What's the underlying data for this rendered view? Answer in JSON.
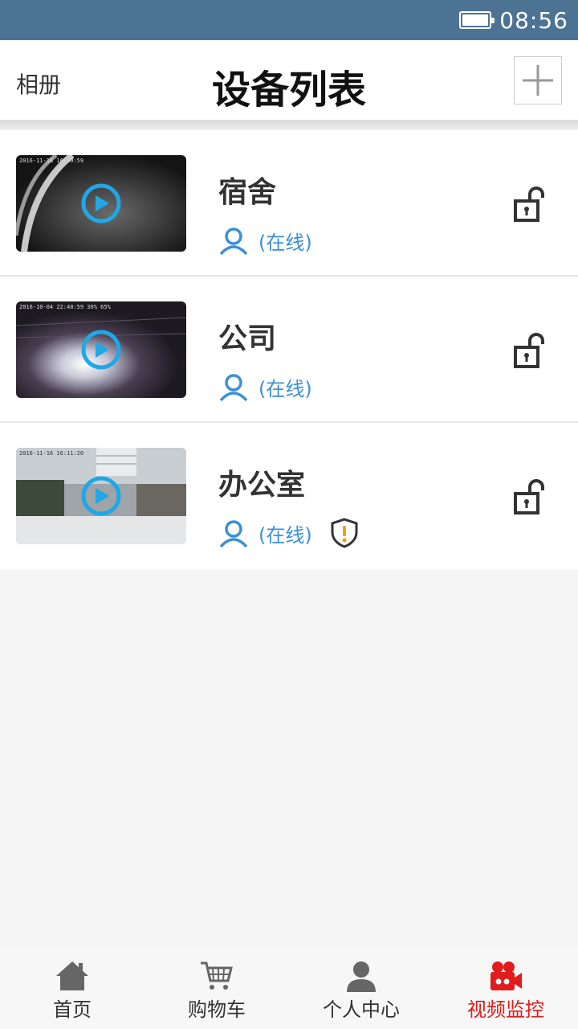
{
  "status_bar": {
    "time": "08:56"
  },
  "header": {
    "left_label": "相册",
    "title": "设备列表"
  },
  "devices": [
    {
      "name": "宿舍",
      "status": "(在线)",
      "thumb_overlay": "2016-11-16  16:19:59"
    },
    {
      "name": "公司",
      "status": "(在线)",
      "thumb_overlay": "2016-10-04  22:48:59  30%  65%"
    },
    {
      "name": "办公室",
      "status": "(在线)",
      "thumb_overlay": "2016-11-16  16:11:20"
    }
  ],
  "bottom_nav": {
    "items": [
      {
        "label": "首页",
        "icon": "home-icon"
      },
      {
        "label": "购物车",
        "icon": "cart-icon"
      },
      {
        "label": "个人中心",
        "icon": "person-icon"
      },
      {
        "label": "视频监控",
        "icon": "video-camera-icon"
      }
    ],
    "active_index": 3
  },
  "colors": {
    "status_bar": "#4d7394",
    "accent_blue": "#3a8fd8",
    "active_red": "#e01c1c",
    "alert_orange": "#f0a000"
  }
}
